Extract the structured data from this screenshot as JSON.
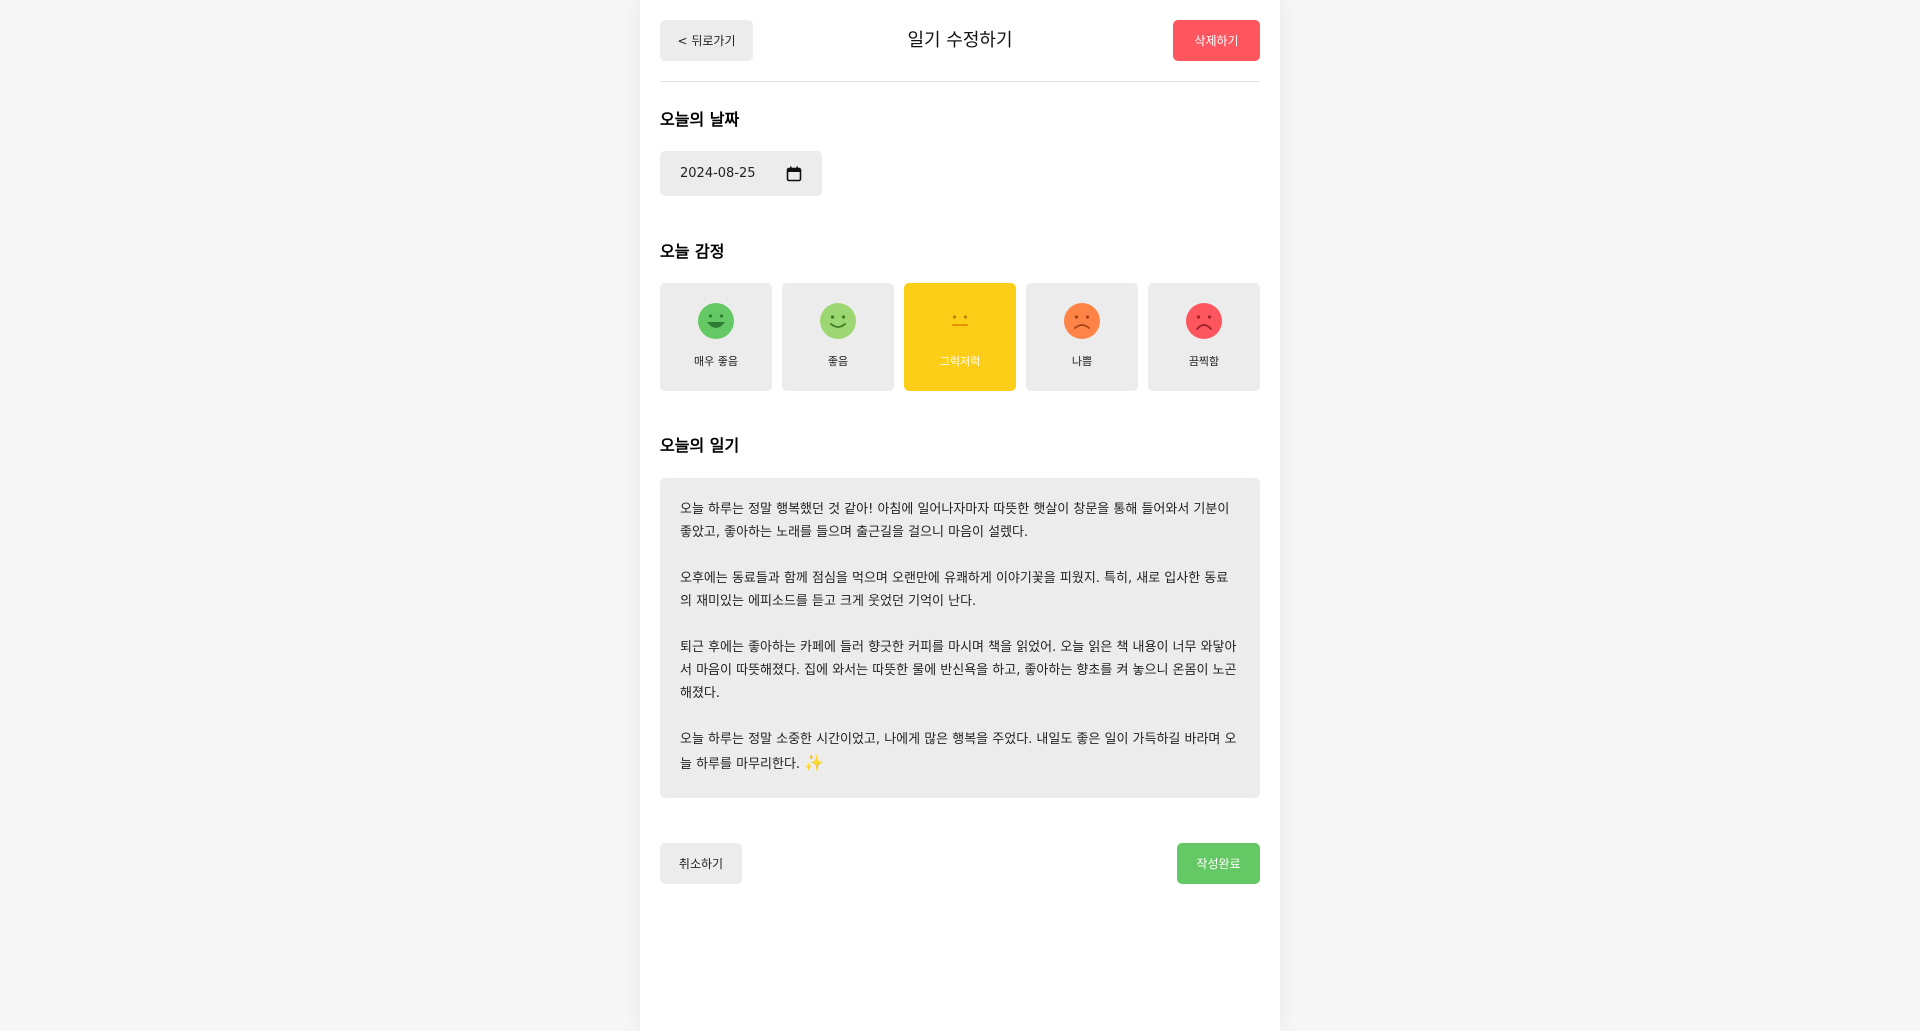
{
  "header": {
    "back_label": "< 뒤로가기",
    "title": "일기 수정하기",
    "delete_label": "삭제하기"
  },
  "date_section": {
    "title": "오늘의 날짜",
    "value": "2024-08-25"
  },
  "emotion_section": {
    "title": "오늘 감정",
    "items": [
      {
        "label": "매우 좋음",
        "color": "#64c964",
        "face": "very-happy",
        "selected": false
      },
      {
        "label": "좋음",
        "color": "#9dd772",
        "face": "happy",
        "selected": false
      },
      {
        "label": "그럭저럭",
        "color": "#fdce17",
        "face": "neutral",
        "selected": true
      },
      {
        "label": "나쁨",
        "color": "#fd8446",
        "face": "sad",
        "selected": false
      },
      {
        "label": "끔찍함",
        "color": "#fd565f",
        "face": "very-sad",
        "selected": false
      }
    ]
  },
  "diary_section": {
    "title": "오늘의 일기",
    "paragraphs": [
      "오늘 하루는 정말 행복했던 것 같아! 아침에 일어나자마자 따뜻한 햇살이 창문을 통해 들어와서 기분이 좋았고, 좋아하는 노래를 들으며 출근길을 걸으니 마음이 설렜다.",
      "오후에는 동료들과 함께 점심을 먹으며 오랜만에 유쾌하게 이야기꽃을 피웠지. 특히, 새로 입사한 동료의 재미있는 에피소드를 듣고 크게 웃었던 기억이 난다.",
      "퇴근 후에는 좋아하는 카페에 들러 향긋한 커피를 마시며 책을 읽었어. 오늘 읽은 책 내용이 너무 와닿아서 마음이 따뜻해졌다. 집에 와서는 따뜻한 물에 반신욕을 하고, 좋아하는 향초를 켜 놓으니 온몸이 노곤해졌다.",
      "오늘 하루는 정말 소중한 시간이었고, 나에게 많은 행복을 주었다. 내일도 좋은 일이 가득하길 바라며 오늘 하루를 마무리한다."
    ],
    "sparkle": "✨"
  },
  "footer": {
    "cancel_label": "취소하기",
    "complete_label": "작성완료"
  },
  "colors": {
    "delete": "#fd565f",
    "complete": "#64c964",
    "selected_emotion": "#fdce17",
    "input_bg": "#ececec"
  }
}
